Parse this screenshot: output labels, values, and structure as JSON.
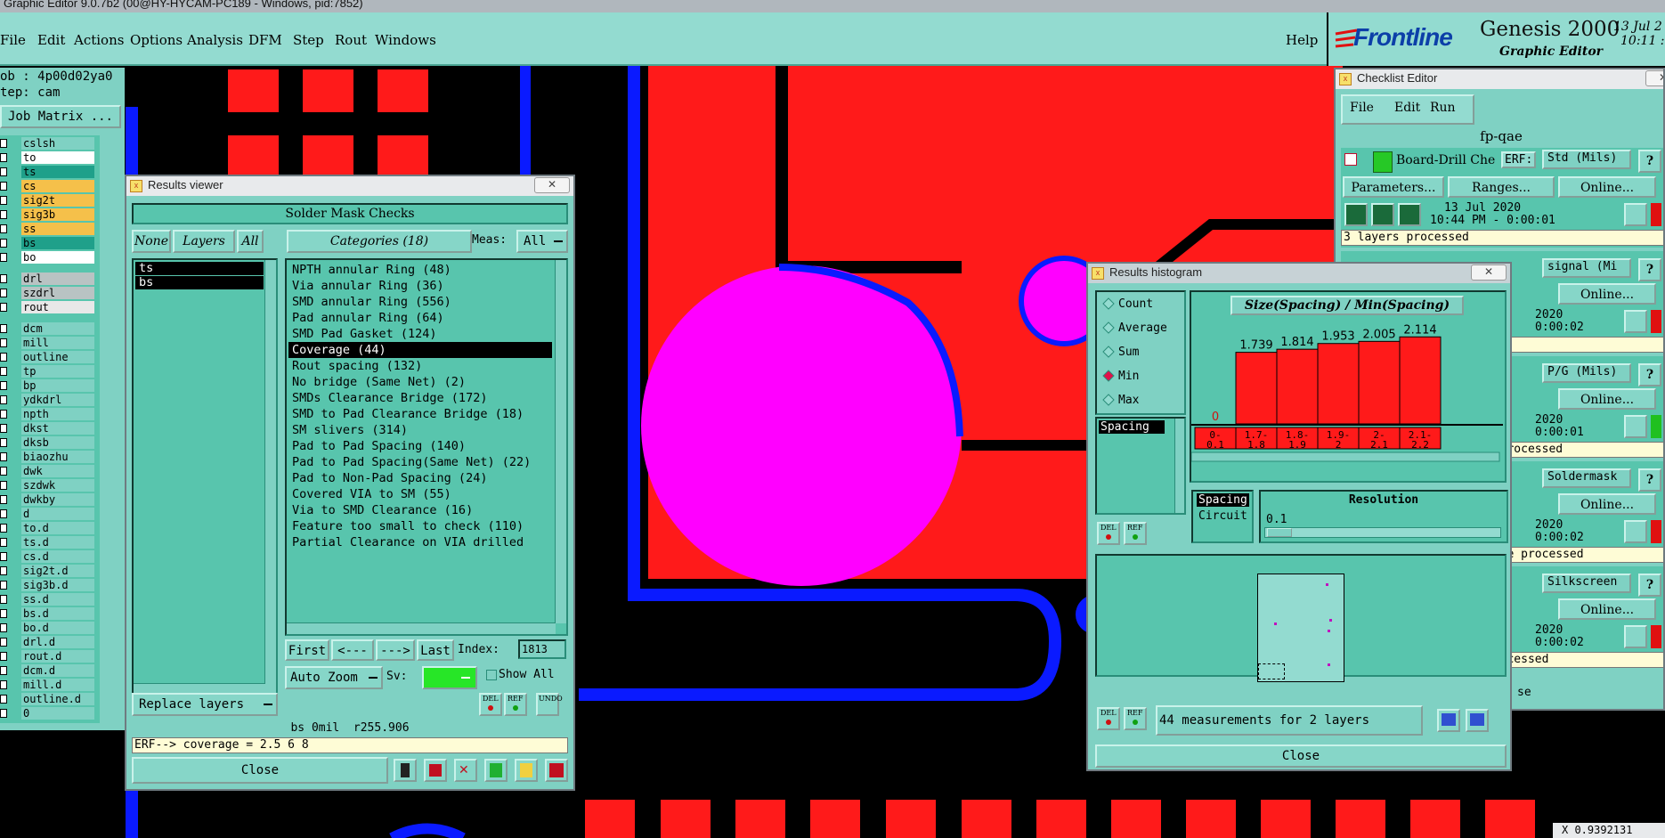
{
  "window": {
    "title": "Graphic Editor 9.0.7b2 (00@HY-HYCAM-PC189 - Windows, pid:7852)"
  },
  "menu": {
    "items": [
      "File",
      "Edit",
      "Actions",
      "Options",
      "Analysis",
      "DFM",
      "Step",
      "Rout",
      "Windows"
    ],
    "help": "Help"
  },
  "brand": {
    "logo": "Frontline",
    "product": "Genesis 2000",
    "subtitle": "Graphic Editor",
    "date": "13 Jul 2",
    "time": "10:11 :"
  },
  "job": {
    "job_label": "ob : 4p00d02ya0",
    "step_label": "tep: cam",
    "matrix_button": "Job Matrix ..."
  },
  "layers": [
    {
      "name": "cslsh",
      "color": "#7fd1c3"
    },
    {
      "name": "to",
      "color": "#ffffff"
    },
    {
      "name": "ts",
      "color": "#1fa08a"
    },
    {
      "name": "cs",
      "color": "#f5c04a"
    },
    {
      "name": "sig2t",
      "color": "#f5c04a"
    },
    {
      "name": "sig3b",
      "color": "#f5c04a"
    },
    {
      "name": "ss",
      "color": "#f5c04a"
    },
    {
      "name": "bs",
      "color": "#1fa08a"
    },
    {
      "name": "bo",
      "color": "#ffffff"
    },
    {
      "name": "drl",
      "color": "#b9c3c3"
    },
    {
      "name": "szdrl",
      "color": "#b9c3c3"
    },
    {
      "name": "rout",
      "color": "#e8e8e8"
    },
    {
      "name": "dcm",
      "color": "#7fd1c3"
    },
    {
      "name": "mill",
      "color": "#7fd1c3"
    },
    {
      "name": "outline",
      "color": "#7fd1c3"
    },
    {
      "name": "tp",
      "color": "#7fd1c3"
    },
    {
      "name": "bp",
      "color": "#7fd1c3"
    },
    {
      "name": "ydkdrl",
      "color": "#7fd1c3"
    },
    {
      "name": "npth",
      "color": "#7fd1c3"
    },
    {
      "name": "dkst",
      "color": "#7fd1c3"
    },
    {
      "name": "dksb",
      "color": "#7fd1c3"
    },
    {
      "name": "biaozhu",
      "color": "#7fd1c3"
    },
    {
      "name": "dwk",
      "color": "#7fd1c3"
    },
    {
      "name": "szdwk",
      "color": "#7fd1c3"
    },
    {
      "name": "dwkby",
      "color": "#7fd1c3"
    },
    {
      "name": "d",
      "color": "#7fd1c3"
    },
    {
      "name": "to.d",
      "color": "#7fd1c3"
    },
    {
      "name": "ts.d",
      "color": "#7fd1c3"
    },
    {
      "name": "cs.d",
      "color": "#7fd1c3"
    },
    {
      "name": "sig2t.d",
      "color": "#7fd1c3"
    },
    {
      "name": "sig3b.d",
      "color": "#7fd1c3"
    },
    {
      "name": "ss.d",
      "color": "#7fd1c3"
    },
    {
      "name": "bs.d",
      "color": "#7fd1c3"
    },
    {
      "name": "bo.d",
      "color": "#7fd1c3"
    },
    {
      "name": "drl.d",
      "color": "#7fd1c3"
    },
    {
      "name": "rout.d",
      "color": "#7fd1c3"
    },
    {
      "name": "dcm.d",
      "color": "#7fd1c3"
    },
    {
      "name": "mill.d",
      "color": "#7fd1c3"
    },
    {
      "name": "outline.d",
      "color": "#7fd1c3"
    },
    {
      "name": "0",
      "color": "#7fd1c3"
    }
  ],
  "results_viewer": {
    "title": "Results viewer",
    "header": "Solder Mask Checks",
    "none_btn": "None",
    "layers_btn": "Layers",
    "all_btn": "All",
    "categories_btn": "Categories (18)",
    "meas_label": "Meas:",
    "meas_value": "All",
    "selected_layers": [
      "ts",
      "bs"
    ],
    "categories": [
      "NPTH annular Ring (48)",
      "Via annular Ring (36)",
      "SMD annular Ring (556)",
      "Pad annular Ring (64)",
      "SMD Pad Gasket (124)",
      "Coverage (44)",
      "Rout spacing (132)",
      "No bridge (Same Net) (2)",
      "SMDs Clearance Bridge (172)",
      "SMD to Pad Clearance Bridge (18)",
      "SM slivers (314)",
      "Pad to Pad Spacing (140)",
      "Pad to Pad Spacing(Same Net) (22)",
      "Pad to Non-Pad Spacing (24)",
      "Covered VIA to SM (55)",
      "Via to SMD Clearance (16)",
      "Feature too small to check (110)",
      "Partial Clearance on VIA drilled"
    ],
    "first_btn": "First",
    "prev_btn": "<---",
    "next_btn": "--->",
    "last_btn": "Last",
    "index_label": "Index:",
    "index_value": "1813",
    "autozoom_btn": "Auto Zoom",
    "sv_label": "Sv:",
    "show_all_label": "Show All",
    "replace_btn": "Replace layers",
    "status": "bs 0mil  r255.906",
    "erf_line": "ERF--> coverage = 2.5 6 8",
    "close_btn": "Close",
    "icon_labels": {
      "del": "DEL",
      "ref": "REF",
      "undo": "UNDO"
    }
  },
  "histogram": {
    "title": "Results histogram",
    "chart_title": "Size(Spacing) / Min(Spacing)",
    "options": [
      "Count",
      "Average",
      "Sum",
      "Min",
      "Max"
    ],
    "selected_option": "Min",
    "list_selected": "Spacing",
    "field_options": [
      "Spacing",
      "Circuit"
    ],
    "resolution_label": "Resolution",
    "resolution_value": "0.1",
    "summary": "44 measurements for 2 layers",
    "close_btn": "Close",
    "icon_labels": {
      "del": "DEL",
      "ref": "REF"
    }
  },
  "chart_data": {
    "type": "bar",
    "title": "Size(Spacing) / Min(Spacing)",
    "categories": [
      "0-\n0.1",
      "1.7-\n1.8",
      "1.8-\n1.9",
      "1.9-\n2",
      "2-\n2.1",
      "2.1-\n2.2"
    ],
    "values": [
      0,
      1.739,
      1.814,
      1.953,
      2.005,
      2.114
    ],
    "value_labels": [
      "0",
      "1.739",
      "1.814",
      "1.953",
      "2.005",
      "2.114"
    ],
    "ylim": [
      0,
      2.25
    ],
    "grid": false,
    "bar_color": "#ff1a1a"
  },
  "checklist": {
    "title": "Checklist Editor",
    "menu": [
      "File",
      "Edit",
      "Run"
    ],
    "name": "fp-qae",
    "check_name": "Board-Drill Che",
    "erf_label": "ERF:",
    "erf_value": "Std (Mils)",
    "params_btn": "Parameters...",
    "ranges_btn": "Ranges...",
    "online_btn": "Online...",
    "run_date": "13 Jul 2020",
    "run_time": "10:44 PM - 0:00:01",
    "status_line": "3 layers processed",
    "rows": [
      {
        "erf": "signal (Mi",
        "year": "2020",
        "elapsed": "0:00:02",
        "status": "ed"
      },
      {
        "erf": "P/G (Mils)",
        "year": "2020",
        "elapsed": "0:00:01",
        "status": "s processed"
      },
      {
        "erf": "Soldermask",
        "year": "2020",
        "elapsed": "0:00:02",
        "status": "were processed"
      },
      {
        "erf": "Silkscreen",
        "year": "2020",
        "elapsed": "0:00:02",
        "status": "processed"
      }
    ],
    "footer_frag": "se"
  },
  "coord_readout": "X 0.9392131"
}
